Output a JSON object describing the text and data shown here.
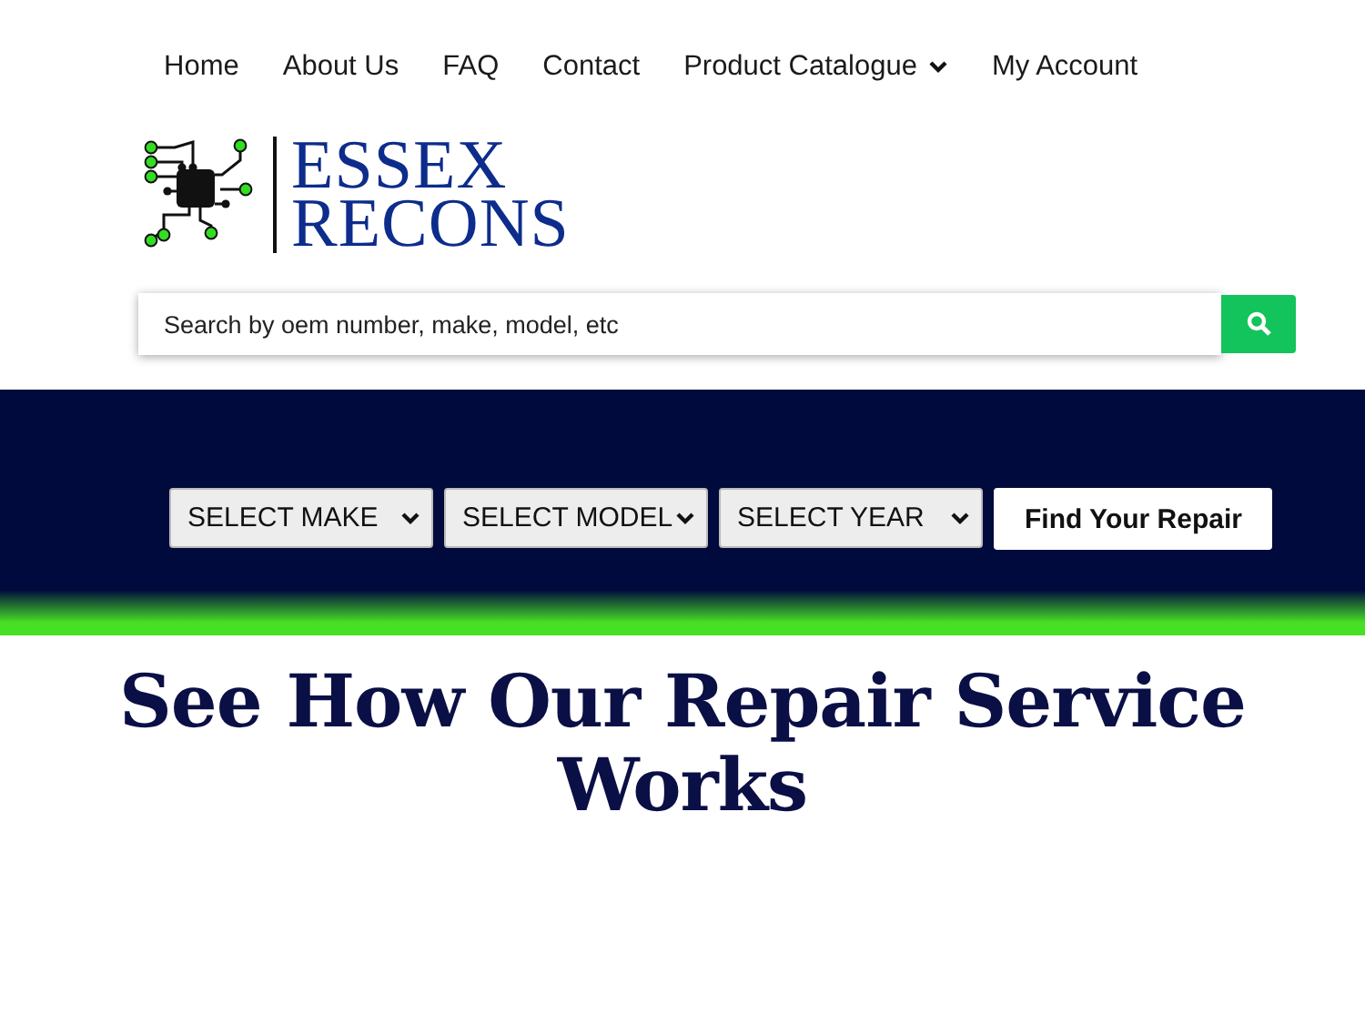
{
  "nav": [
    {
      "label": "Home",
      "has_submenu": false
    },
    {
      "label": "About Us",
      "has_submenu": false
    },
    {
      "label": "FAQ",
      "has_submenu": false
    },
    {
      "label": "Contact",
      "has_submenu": false
    },
    {
      "label": "Product Catalogue",
      "has_submenu": true
    },
    {
      "label": "My Account",
      "has_submenu": false
    }
  ],
  "logo": {
    "line_1": "ESSEX",
    "line_2": "RECONS"
  },
  "search": {
    "placeholder": "Search by oem number, make, model, etc"
  },
  "filters": [
    {
      "value": "SELECT MAKE"
    },
    {
      "value": "SELECT MODEL"
    },
    {
      "value": "SELECT YEAR"
    }
  ],
  "find_button": "Find Your Repair",
  "heading": "See How Our Repair Service Works"
}
